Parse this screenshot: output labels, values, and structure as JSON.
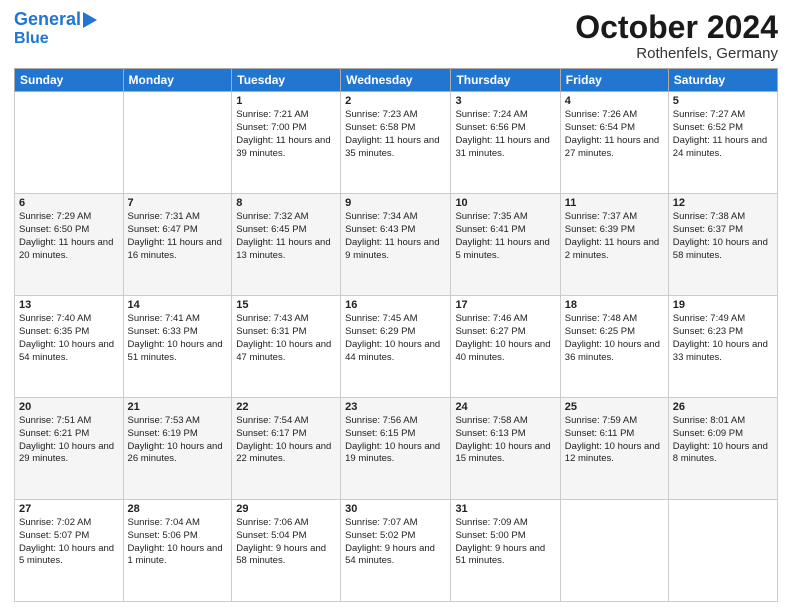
{
  "header": {
    "logo_line1": "General",
    "logo_line2": "Blue",
    "month": "October 2024",
    "location": "Rothenfels, Germany"
  },
  "weekdays": [
    "Sunday",
    "Monday",
    "Tuesday",
    "Wednesday",
    "Thursday",
    "Friday",
    "Saturday"
  ],
  "weeks": [
    [
      {
        "day": "",
        "text": ""
      },
      {
        "day": "",
        "text": ""
      },
      {
        "day": "1",
        "text": "Sunrise: 7:21 AM\nSunset: 7:00 PM\nDaylight: 11 hours and 39 minutes."
      },
      {
        "day": "2",
        "text": "Sunrise: 7:23 AM\nSunset: 6:58 PM\nDaylight: 11 hours and 35 minutes."
      },
      {
        "day": "3",
        "text": "Sunrise: 7:24 AM\nSunset: 6:56 PM\nDaylight: 11 hours and 31 minutes."
      },
      {
        "day": "4",
        "text": "Sunrise: 7:26 AM\nSunset: 6:54 PM\nDaylight: 11 hours and 27 minutes."
      },
      {
        "day": "5",
        "text": "Sunrise: 7:27 AM\nSunset: 6:52 PM\nDaylight: 11 hours and 24 minutes."
      }
    ],
    [
      {
        "day": "6",
        "text": "Sunrise: 7:29 AM\nSunset: 6:50 PM\nDaylight: 11 hours and 20 minutes."
      },
      {
        "day": "7",
        "text": "Sunrise: 7:31 AM\nSunset: 6:47 PM\nDaylight: 11 hours and 16 minutes."
      },
      {
        "day": "8",
        "text": "Sunrise: 7:32 AM\nSunset: 6:45 PM\nDaylight: 11 hours and 13 minutes."
      },
      {
        "day": "9",
        "text": "Sunrise: 7:34 AM\nSunset: 6:43 PM\nDaylight: 11 hours and 9 minutes."
      },
      {
        "day": "10",
        "text": "Sunrise: 7:35 AM\nSunset: 6:41 PM\nDaylight: 11 hours and 5 minutes."
      },
      {
        "day": "11",
        "text": "Sunrise: 7:37 AM\nSunset: 6:39 PM\nDaylight: 11 hours and 2 minutes."
      },
      {
        "day": "12",
        "text": "Sunrise: 7:38 AM\nSunset: 6:37 PM\nDaylight: 10 hours and 58 minutes."
      }
    ],
    [
      {
        "day": "13",
        "text": "Sunrise: 7:40 AM\nSunset: 6:35 PM\nDaylight: 10 hours and 54 minutes."
      },
      {
        "day": "14",
        "text": "Sunrise: 7:41 AM\nSunset: 6:33 PM\nDaylight: 10 hours and 51 minutes."
      },
      {
        "day": "15",
        "text": "Sunrise: 7:43 AM\nSunset: 6:31 PM\nDaylight: 10 hours and 47 minutes."
      },
      {
        "day": "16",
        "text": "Sunrise: 7:45 AM\nSunset: 6:29 PM\nDaylight: 10 hours and 44 minutes."
      },
      {
        "day": "17",
        "text": "Sunrise: 7:46 AM\nSunset: 6:27 PM\nDaylight: 10 hours and 40 minutes."
      },
      {
        "day": "18",
        "text": "Sunrise: 7:48 AM\nSunset: 6:25 PM\nDaylight: 10 hours and 36 minutes."
      },
      {
        "day": "19",
        "text": "Sunrise: 7:49 AM\nSunset: 6:23 PM\nDaylight: 10 hours and 33 minutes."
      }
    ],
    [
      {
        "day": "20",
        "text": "Sunrise: 7:51 AM\nSunset: 6:21 PM\nDaylight: 10 hours and 29 minutes."
      },
      {
        "day": "21",
        "text": "Sunrise: 7:53 AM\nSunset: 6:19 PM\nDaylight: 10 hours and 26 minutes."
      },
      {
        "day": "22",
        "text": "Sunrise: 7:54 AM\nSunset: 6:17 PM\nDaylight: 10 hours and 22 minutes."
      },
      {
        "day": "23",
        "text": "Sunrise: 7:56 AM\nSunset: 6:15 PM\nDaylight: 10 hours and 19 minutes."
      },
      {
        "day": "24",
        "text": "Sunrise: 7:58 AM\nSunset: 6:13 PM\nDaylight: 10 hours and 15 minutes."
      },
      {
        "day": "25",
        "text": "Sunrise: 7:59 AM\nSunset: 6:11 PM\nDaylight: 10 hours and 12 minutes."
      },
      {
        "day": "26",
        "text": "Sunrise: 8:01 AM\nSunset: 6:09 PM\nDaylight: 10 hours and 8 minutes."
      }
    ],
    [
      {
        "day": "27",
        "text": "Sunrise: 7:02 AM\nSunset: 5:07 PM\nDaylight: 10 hours and 5 minutes."
      },
      {
        "day": "28",
        "text": "Sunrise: 7:04 AM\nSunset: 5:06 PM\nDaylight: 10 hours and 1 minute."
      },
      {
        "day": "29",
        "text": "Sunrise: 7:06 AM\nSunset: 5:04 PM\nDaylight: 9 hours and 58 minutes."
      },
      {
        "day": "30",
        "text": "Sunrise: 7:07 AM\nSunset: 5:02 PM\nDaylight: 9 hours and 54 minutes."
      },
      {
        "day": "31",
        "text": "Sunrise: 7:09 AM\nSunset: 5:00 PM\nDaylight: 9 hours and 51 minutes."
      },
      {
        "day": "",
        "text": ""
      },
      {
        "day": "",
        "text": ""
      }
    ]
  ]
}
